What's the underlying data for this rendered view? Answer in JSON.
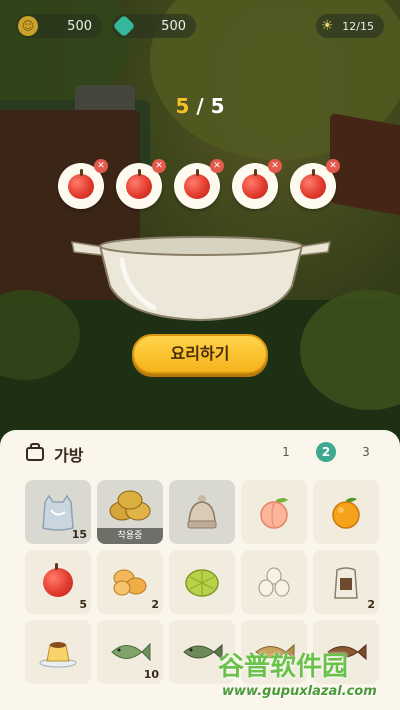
{
  "topbar": {
    "coins": "500",
    "gems": "500",
    "energy": "12/15",
    "coin_icon": "coin-icon",
    "gem_icon": "gem-icon",
    "energy_icon": "sun-icon"
  },
  "cooking": {
    "progress_current": "5",
    "progress_sep": " / ",
    "progress_total": "5",
    "slots": [
      "apple",
      "apple",
      "apple",
      "apple",
      "apple"
    ],
    "cook_button": "요리하기"
  },
  "bag": {
    "title": "가방",
    "pages": [
      "1",
      "2",
      "3"
    ],
    "active_page": "2",
    "items": [
      {
        "name": "plastic-bag",
        "count": "15",
        "selected": true
      },
      {
        "name": "potato-pile",
        "equip_label": "착용중",
        "selected": true
      },
      {
        "name": "knit-hat",
        "selected": true
      },
      {
        "name": "peach"
      },
      {
        "name": "orange"
      },
      {
        "name": "apple",
        "count": "5"
      },
      {
        "name": "bread-rolls",
        "count": "2"
      },
      {
        "name": "melon-bread"
      },
      {
        "name": "eggs"
      },
      {
        "name": "flour-sack",
        "count": "2"
      },
      {
        "name": "pudding"
      },
      {
        "name": "fish",
        "count": "10"
      },
      {
        "name": "catfish"
      },
      {
        "name": "fish-2"
      },
      {
        "name": "grilled-fish"
      }
    ]
  },
  "watermark": {
    "title": "谷普软件园",
    "url": "www.gupuxlazal.com"
  },
  "colors": {
    "accent": "#3fa891",
    "button": "#f5b41c",
    "remove": "#e35a4c",
    "progress_highlight": "#f6c12b"
  }
}
